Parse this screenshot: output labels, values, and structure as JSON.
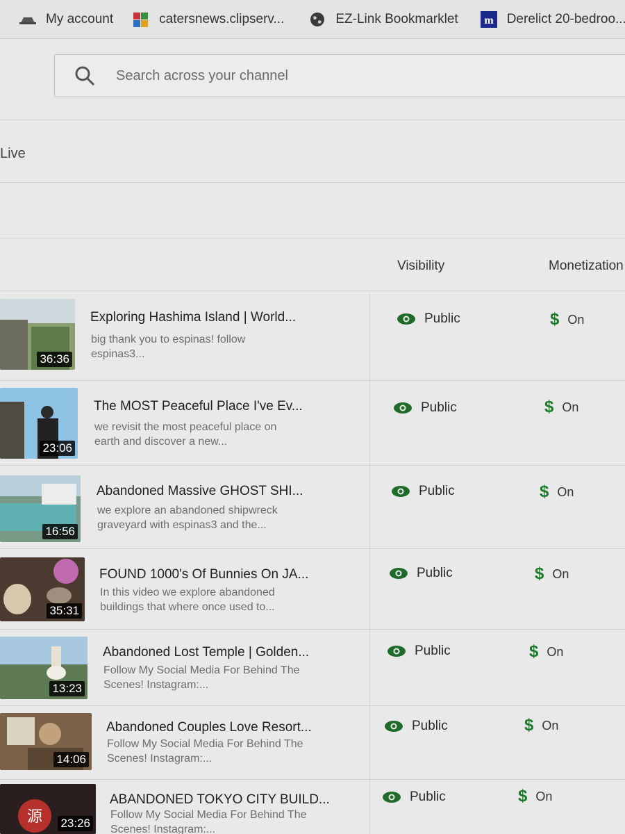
{
  "bookmarks": [
    {
      "label": "My account",
      "icon": "cloud-icon"
    },
    {
      "label": "catersnews.clipserv...",
      "icon": "cube-icon"
    },
    {
      "label": "EZ-Link Bookmarklet",
      "icon": "globe-icon"
    },
    {
      "label": "Derelict 20-bedroo...",
      "icon": "m-logo-icon"
    }
  ],
  "search": {
    "placeholder": "Search across your channel"
  },
  "tabs": {
    "live": "Live"
  },
  "columns": {
    "visibility": "Visibility",
    "monetization": "Monetization"
  },
  "colors": {
    "eye": "#1e6b2a",
    "dollar": "#1c7a2b"
  },
  "videos": [
    {
      "title": "Exploring Hashima Island | World...",
      "description": "big thank you to espinas! follow espinas3...",
      "duration": "36:36",
      "visibility": "Public",
      "monetization": "On"
    },
    {
      "title": "The MOST Peaceful Place I've Ev...",
      "description": "we revisit the most peaceful place on earth and discover a new...",
      "duration": "23:06",
      "visibility": "Public",
      "monetization": "On"
    },
    {
      "title": "Abandoned Massive GHOST SHI...",
      "description": "we explore an abandoned shipwreck graveyard with espinas3 and the...",
      "duration": "16:56",
      "visibility": "Public",
      "monetization": "On"
    },
    {
      "title": "FOUND 1000's Of Bunnies On JA...",
      "description": "In this video we explore abandoned buildings that where once used to...",
      "duration": "35:31",
      "visibility": "Public",
      "monetization": "On"
    },
    {
      "title": "Abandoned Lost Temple | Golden...",
      "description": "Follow My Social Media For Behind The Scenes! Instagram:...",
      "duration": "13:23",
      "visibility": "Public",
      "monetization": "On"
    },
    {
      "title": "Abandoned Couples Love Resort...",
      "description": "Follow My Social Media For Behind The Scenes! Instagram:...",
      "duration": "14:06",
      "visibility": "Public",
      "monetization": "On"
    },
    {
      "title": "ABANDONED TOKYO CITY BUILD...",
      "description": "Follow My Social Media For Behind The Scenes! Instagram:...",
      "duration": "23:26",
      "visibility": "Public",
      "monetization": "On"
    }
  ]
}
